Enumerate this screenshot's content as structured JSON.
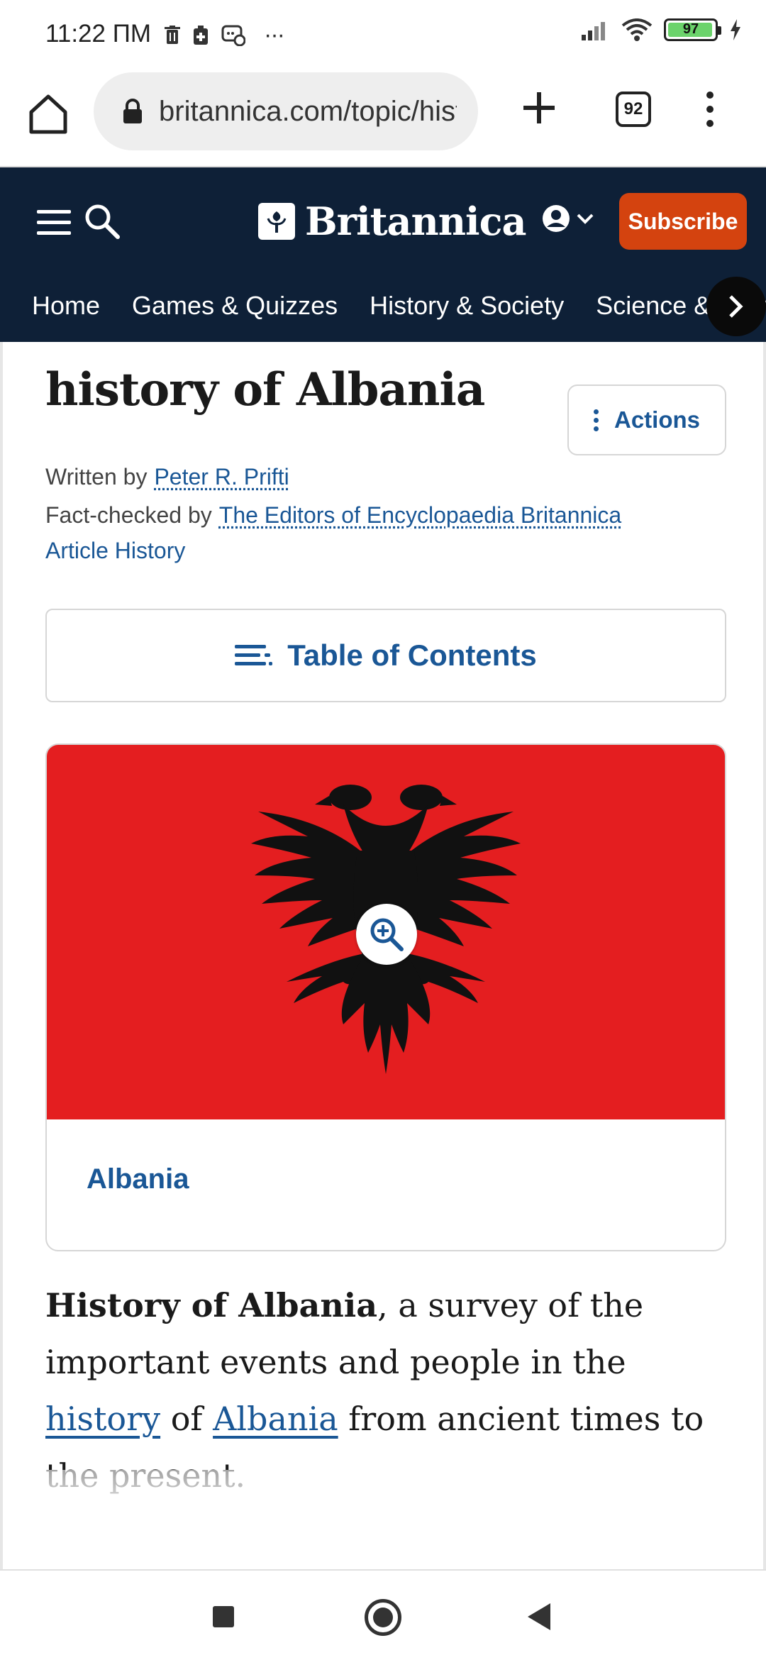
{
  "status_bar": {
    "time": "11:22 ПМ",
    "battery": "97",
    "battery_level": 0.97,
    "icons": [
      "trash-icon",
      "sim-icon",
      "chat-icon",
      "more-dots-icon",
      "signal-icon",
      "wifi-icon",
      "battery-icon",
      "charging-icon"
    ],
    "overflow": "···"
  },
  "browser": {
    "url": "britannica.com/topic/history-of-Albania",
    "tab_count": "92",
    "icons": [
      "home-icon",
      "lock-icon",
      "plus-icon",
      "tabs-icon",
      "kebab-menu-icon"
    ]
  },
  "header": {
    "logo_text": "Britannica",
    "subscribe_label": "Subscribe",
    "brand_color": "#0e2037",
    "accent_color": "#d4430f",
    "nav_items": [
      "Home",
      "Games & Quizzes",
      "History & Society",
      "Science & Tech"
    ]
  },
  "article": {
    "title": "history of Albania",
    "actions_label": "Actions",
    "written_by_label": "Written by",
    "author": "Peter R. Prifti",
    "fact_checked_label": "Fact-checked by",
    "fact_checker": "The Editors of Encyclopaedia Britannica",
    "article_history": "Article History",
    "toc_label": "Table of Contents",
    "media_caption": "Albania",
    "link_color": "#1a5796",
    "lead": {
      "bold": "History of Albania",
      "part1": ", a survey of the important events and people in the ",
      "link1": "history",
      "part2": " of ",
      "link2": "Albania",
      "part3": " from ancient times to the present."
    }
  },
  "system_nav": {
    "icons": [
      "recent-apps-icon",
      "home-circle-icon",
      "back-icon"
    ]
  }
}
